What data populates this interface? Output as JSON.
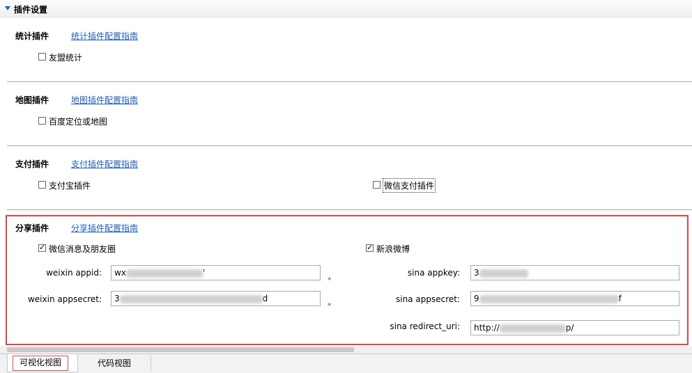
{
  "header": {
    "title": "插件设置"
  },
  "stats": {
    "title": "统计插件",
    "guide": "统计插件配置指南",
    "options": [
      {
        "label": "友盟统计",
        "checked": false
      }
    ]
  },
  "map": {
    "title": "地图插件",
    "guide": "地图插件配置指南",
    "options": [
      {
        "label": "百度定位或地图",
        "checked": false
      }
    ]
  },
  "payment": {
    "title": "支付插件",
    "guide": "支付插件配置指南",
    "options": [
      {
        "label": "支付宝插件",
        "checked": false
      },
      {
        "label": "微信支付插件",
        "checked": false
      }
    ]
  },
  "share": {
    "title": "分享插件",
    "guide": "分享插件配置指南",
    "weixin": {
      "label": "微信消息及朋友圈",
      "checked": true,
      "appid_label": "weixin appid:",
      "appid_prefix": "wx",
      "appid_suffix": "'",
      "appsecret_label": "weixin appsecret:",
      "appsecret_prefix": "3",
      "appsecret_suffix": "d",
      "required_mark": "*"
    },
    "sina": {
      "label": "新浪微博",
      "checked": true,
      "appkey_label": "sina appkey:",
      "appkey_prefix": "3",
      "appsecret_label": "sina appsecret:",
      "appsecret_prefix": "9",
      "appsecret_suffix": "f",
      "redirect_label": "sina redirect_uri:",
      "redirect_prefix": "http://",
      "redirect_suffix": "p/"
    }
  },
  "tabs": [
    {
      "label": "可视化视图",
      "active": true
    },
    {
      "label": "代码视图",
      "active": false
    }
  ]
}
